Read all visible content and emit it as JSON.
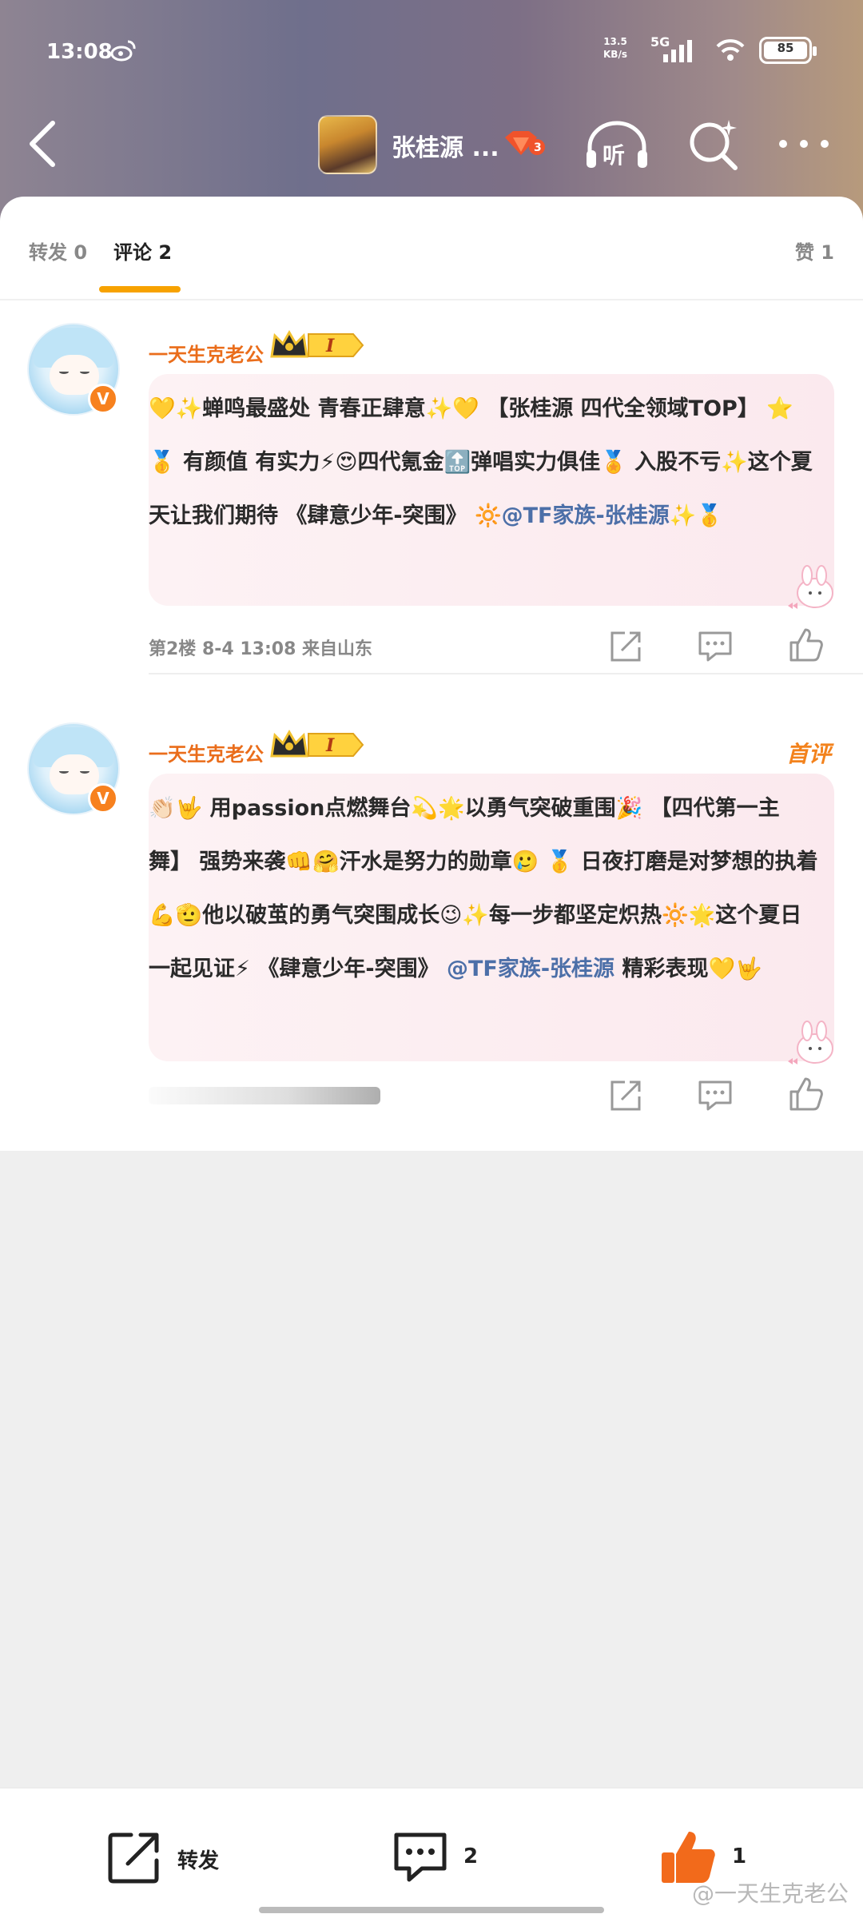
{
  "status_bar": {
    "time": "13:08",
    "net_speed_value": "13.5",
    "net_speed_unit": "KB/s",
    "network": "5G",
    "battery": "85"
  },
  "nav": {
    "title": "张桂源 ...",
    "listen_label": "听"
  },
  "tabs": {
    "repost": "转发 0",
    "comments": "评论 2",
    "likes": "赞 1"
  },
  "comments": [
    {
      "username": "一天生克老公",
      "crown_level": "I",
      "text_before_mention": "💛✨蝉鸣最盛处  青春正肆意✨💛 【张桂源  四代全领域TOP】 ⭐🥇 有颜值  有实力⚡😍四代氪金🔝弹唱实力俱佳🏅 入股不亏✨这个夏天让我们期待 《肆意少年-突围》 🔆",
      "mention": "@TF家族-张桂源",
      "text_after_mention": "✨🥇",
      "meta": "第2楼   8-4   13:08   来自山东"
    },
    {
      "username": "一天生克老公",
      "crown_level": "I",
      "first_badge": "首评",
      "text_before_mention": "👏🏻🤟 用passion点燃舞台💫🌟以勇气突破重围🎉 【四代第一主舞】 强势来袭👊🤗汗水是努力的勋章🥲 🥇 日夜打磨是对梦想的执着💪🫡他以破茧的勇气突围成长😉✨每一步都坚定炽热🔆🌟这个夏日一起见证⚡ 《肆意少年-突围》 ",
      "mention": "@TF家族-张桂源",
      "text_after_mention": "  精彩表现💛🤟"
    }
  ],
  "bottom_bar": {
    "repost": "转发",
    "comments": "2",
    "likes": "1"
  },
  "watermark": "@一天生克老公",
  "colors": {
    "accent_orange": "#f7a200",
    "username_orange": "#ea6d1b",
    "mention_blue": "#4c6fa8",
    "like_orange": "#f26a1b"
  }
}
